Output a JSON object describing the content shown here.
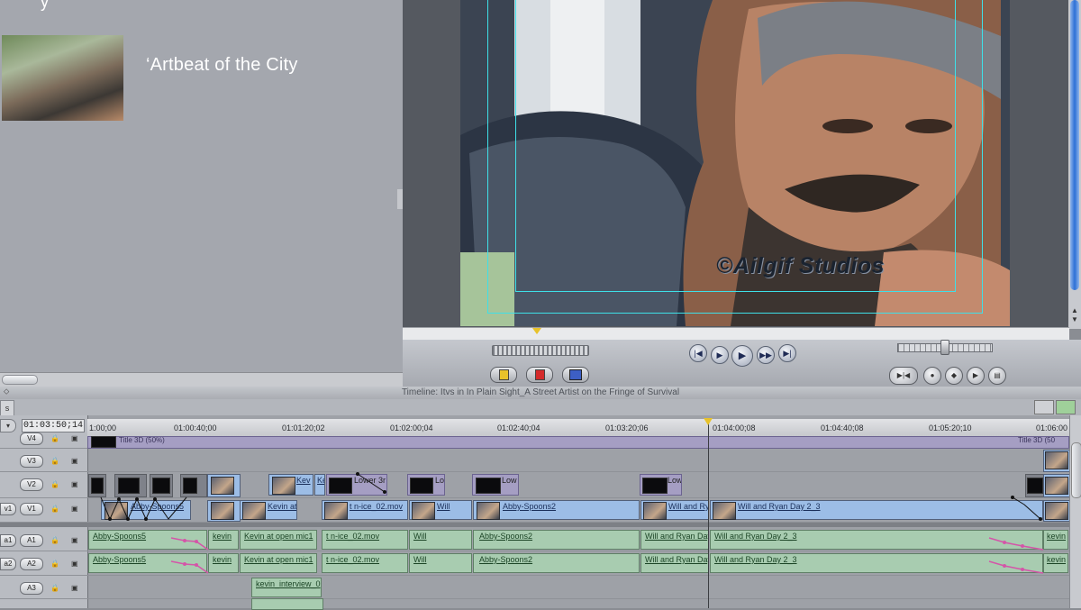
{
  "browser": {
    "title": "‘Artbeat of the City",
    "top_glyph": "y",
    "thumbnail": "street-artist-thumbnail"
  },
  "viewer": {
    "watermark": "©Ailgif Studios",
    "image": "portrait-of-street-artist-in-cap"
  },
  "transport": {
    "buttons": [
      "go-to-start-icon",
      "play-in-to-out-icon",
      "play-icon",
      "play-around-icon",
      "go-to-end-icon"
    ],
    "right_buttons": [
      "match-frame-icon",
      "lock-icon",
      "marker-icon",
      "mark-clip-icon",
      "overwrite-icon"
    ]
  },
  "timeline": {
    "title": "Timeline: Itvs in In Plain Sight_A Street Artist on the Fringe of Survival",
    "tab_label": "s",
    "timecode": "01:03:50;14",
    "ruler_ticks": [
      "1:00;00",
      "01:00:40;00",
      "01:01:20;02",
      "01:02:00;04",
      "01:02:40;04",
      "01:03:20;06",
      "01:04:00;08",
      "01:04:40;08",
      "01:05:20;10",
      "01:06:00"
    ],
    "tracks": [
      {
        "id": "v4",
        "label": "V4",
        "src": ""
      },
      {
        "id": "v3",
        "label": "V3",
        "src": ""
      },
      {
        "id": "v2",
        "label": "V2",
        "src": ""
      },
      {
        "id": "v1",
        "label": "V1",
        "src": "v1"
      },
      {
        "id": "a1",
        "label": "A1",
        "src": "a1"
      },
      {
        "id": "a2",
        "label": "A2",
        "src": "a2"
      },
      {
        "id": "a3",
        "label": "A3",
        "src": ""
      }
    ],
    "v4_text_left": "Title 3D (50%)",
    "v4_text_right": "Title 3D (50",
    "v2_clips": [
      "Kev",
      "Ke",
      "Lower 3r",
      "Lo",
      "Low",
      "Low"
    ],
    "v1_clips": [
      "Abby-Spoons5",
      "Kevin at",
      "t n-ice_02.mov",
      "Will",
      "Abby-Spoons2",
      "Will and Ry",
      "Will and Ryan Day 2_3"
    ],
    "a1_clips": [
      "Abby-Spoons5",
      "kevin",
      "Kevin at open mic1",
      "t n-ice_02.mov",
      "Will",
      "Abby-Spoons2",
      "Will and Ryan Day",
      "Will and Ryan Day 2_3",
      "kevin"
    ],
    "a2_clips": [
      "Abby-Spoons5",
      "kevin",
      "Kevin at open mic1",
      "t n-ice_02.mov",
      "Will",
      "Abby-Spoons2",
      "Will and Ryan Day",
      "Will and Ryan Day 2_3",
      "kevin"
    ],
    "a3_clips": [
      "kevin_interview_0"
    ]
  }
}
